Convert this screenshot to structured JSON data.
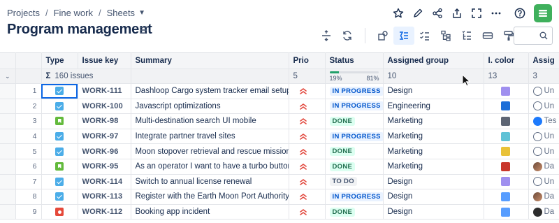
{
  "breadcrumb": [
    "Projects",
    "Fine work",
    "Sheets"
  ],
  "title": "Program management",
  "columns": [
    "Type",
    "Issue key",
    "Summary",
    "Prio",
    "Status",
    "Assigned group",
    "I. color",
    "Assig"
  ],
  "summary": {
    "issues": "160 issues",
    "prio": "5",
    "progress_left": "19%",
    "progress_right": "81%",
    "progress_fraction": 0.19,
    "group": "10",
    "color": "13",
    "assignee": "3"
  },
  "rows": [
    {
      "num": "1",
      "type": "task",
      "key": "WORK-111",
      "summary": "Dashloop Cargo system tracker email setup",
      "status": "IN PROGRESS",
      "group": "Design",
      "color": "#9f8fef",
      "assignee": "Un",
      "avatar": "unassigned"
    },
    {
      "num": "2",
      "type": "task",
      "key": "WORK-100",
      "summary": "Javascript optimizations",
      "status": "IN PROGRESS",
      "group": "Engineering",
      "color": "#1d6ed8",
      "assignee": "Un",
      "avatar": "unassigned"
    },
    {
      "num": "3",
      "type": "story",
      "key": "WORK-98",
      "summary": "Multi-destination search UI mobile",
      "status": "DONE",
      "group": "Marketing",
      "color": "#5d6574",
      "assignee": "Tes",
      "avatar": "blue"
    },
    {
      "num": "4",
      "type": "task",
      "key": "WORK-97",
      "summary": "Integrate partner travel sites",
      "status": "IN PROGRESS",
      "group": "Marketing",
      "color": "#5fc2d6",
      "assignee": "Un",
      "avatar": "unassigned"
    },
    {
      "num": "5",
      "type": "task",
      "key": "WORK-96",
      "summary": "Moon stopover retrieval and rescue mission…",
      "status": "DONE",
      "group": "Marketing",
      "color": "#e9c238",
      "assignee": "Un",
      "avatar": "unassigned"
    },
    {
      "num": "6",
      "type": "story",
      "key": "WORK-95",
      "summary": "As an operator I want to have a turbo button",
      "status": "DONE",
      "group": "Marketing",
      "color": "#c9372c",
      "assignee": "Da",
      "avatar": "photo"
    },
    {
      "num": "7",
      "type": "task",
      "key": "WORK-114",
      "summary": "Switch to annual license renewal",
      "status": "TO DO",
      "group": "Design",
      "color": "#9f8fef",
      "assignee": "Un",
      "avatar": "unassigned"
    },
    {
      "num": "8",
      "type": "task",
      "key": "WORK-113",
      "summary": "Register with the Earth Moon Port Authority",
      "status": "IN PROGRESS",
      "group": "Design",
      "color": "#579dff",
      "assignee": "Da",
      "avatar": "photo"
    },
    {
      "num": "9",
      "type": "bug",
      "key": "WORK-112",
      "summary": "Booking app incident",
      "status": "DONE",
      "group": "Design",
      "color": "#579dff",
      "assignee": "Da",
      "avatar": "dark"
    }
  ]
}
